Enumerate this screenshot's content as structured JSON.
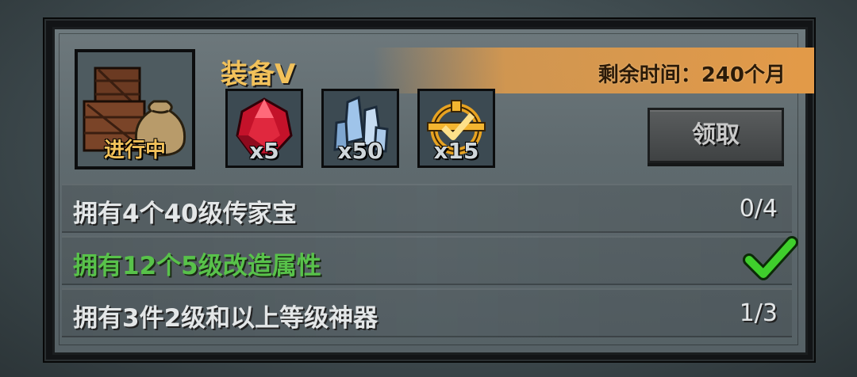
{
  "quest": {
    "title": "装备V",
    "status": "进行中",
    "timer": "剩余时间：240个月",
    "claim_label": "领取"
  },
  "rewards": [
    {
      "icon": "ruby-gem-icon",
      "count": "x5"
    },
    {
      "icon": "blue-crystal-icon",
      "count": "x50"
    },
    {
      "icon": "gold-emblem-icon",
      "count": "x15"
    }
  ],
  "tasks": [
    {
      "text": "拥有4个40级传家宝",
      "progress": "0/4",
      "completed": false
    },
    {
      "text": "拥有12个5级改造属性",
      "progress": "",
      "completed": true
    },
    {
      "text": "拥有3件2级和以上等级神器",
      "progress": "1/3",
      "completed": false
    }
  ],
  "colors": {
    "title": "#f2c15a",
    "timer_bar": "#e39a48",
    "completed_text": "#58c24a"
  }
}
